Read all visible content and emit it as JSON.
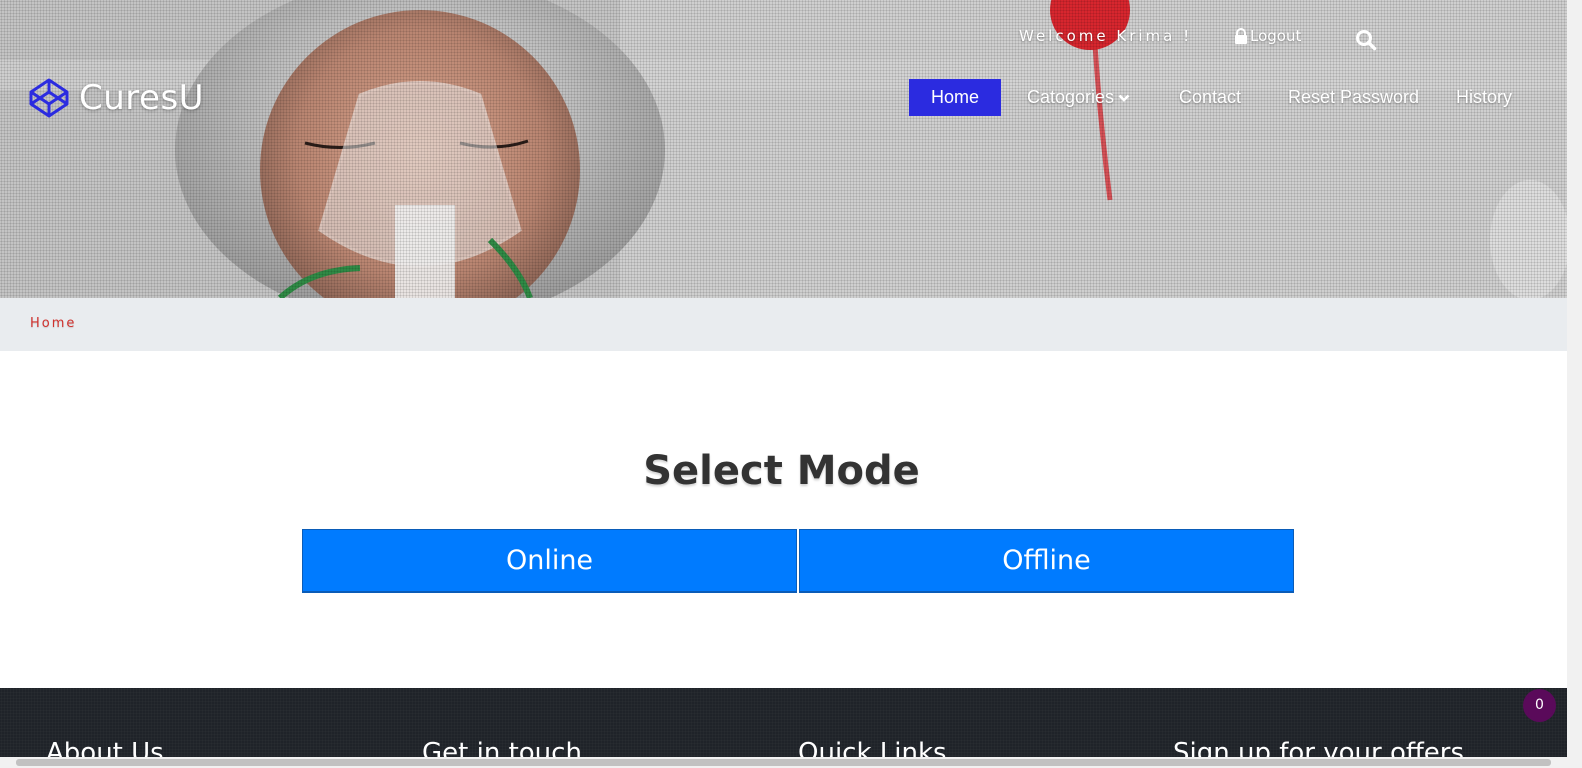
{
  "header": {
    "welcome_text": "Welcome Krima !",
    "logout_label": "Logout",
    "brand_name": "CuresU",
    "nav": {
      "home": "Home",
      "categories": "Catogories",
      "contact": "Contact",
      "reset_password": "Reset Password",
      "history": "History"
    },
    "active_nav": "home",
    "accent_color": "#2b2be0"
  },
  "breadcrumb": {
    "home": "Home"
  },
  "main": {
    "title": "Select Mode",
    "online_label": "Online",
    "offline_label": "Offline",
    "button_color": "#007bff"
  },
  "footer": {
    "about": "About Us",
    "get_in_touch": "Get in touch",
    "quick_links": "Quick Links",
    "signup": "Sign up for your offers",
    "cart_count": "0"
  },
  "icons": {
    "logo": "codepen-cube-icon",
    "logout": "lock-icon",
    "search": "search-icon",
    "categories": "chevron-down-icon"
  }
}
